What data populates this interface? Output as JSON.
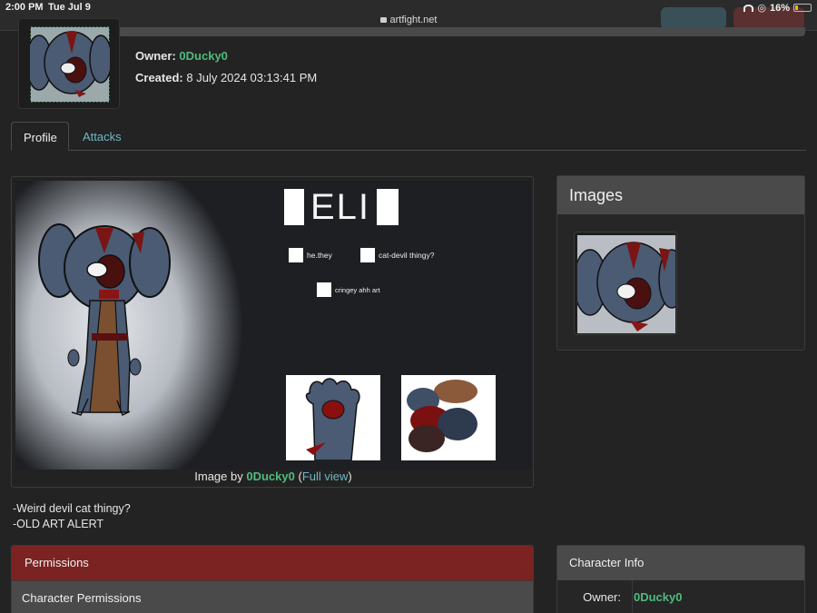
{
  "status_bar": {
    "time": "2:00 PM",
    "date": "Tue Jul 9",
    "url": "artfight.net",
    "battery": "16%",
    "battery_level": 0.16
  },
  "character": {
    "owner_label": "Owner:",
    "owner": "0Ducky0",
    "created_label": "Created:",
    "created": "8 July 2024 03:13:41 PM"
  },
  "tabs": [
    {
      "label": "Profile",
      "active": true
    },
    {
      "label": "Attacks",
      "active": false
    }
  ],
  "main_image": {
    "ref_title": "ELI",
    "tags": [
      "he.they",
      "cat-devil thingy?",
      "cringey ahh art"
    ],
    "caption_prefix": "Image by",
    "caption_artist": "0Ducky0",
    "caption_link": "Full view"
  },
  "description": [
    "-Weird devil cat thingy?",
    "-OLD ART ALERT"
  ],
  "images_panel": {
    "title": "Images"
  },
  "permissions": {
    "title": "Permissions",
    "subtitle": "Character Permissions"
  },
  "character_info": {
    "title": "Character Info",
    "owner_label": "Owner:",
    "owner": "0Ducky0"
  },
  "colors": {
    "background": "#232323",
    "accent_green": "#4fbb7e",
    "link_teal": "#6fb9c4",
    "permissions_red": "#7a2322",
    "panel_header": "#4a4a4a"
  }
}
